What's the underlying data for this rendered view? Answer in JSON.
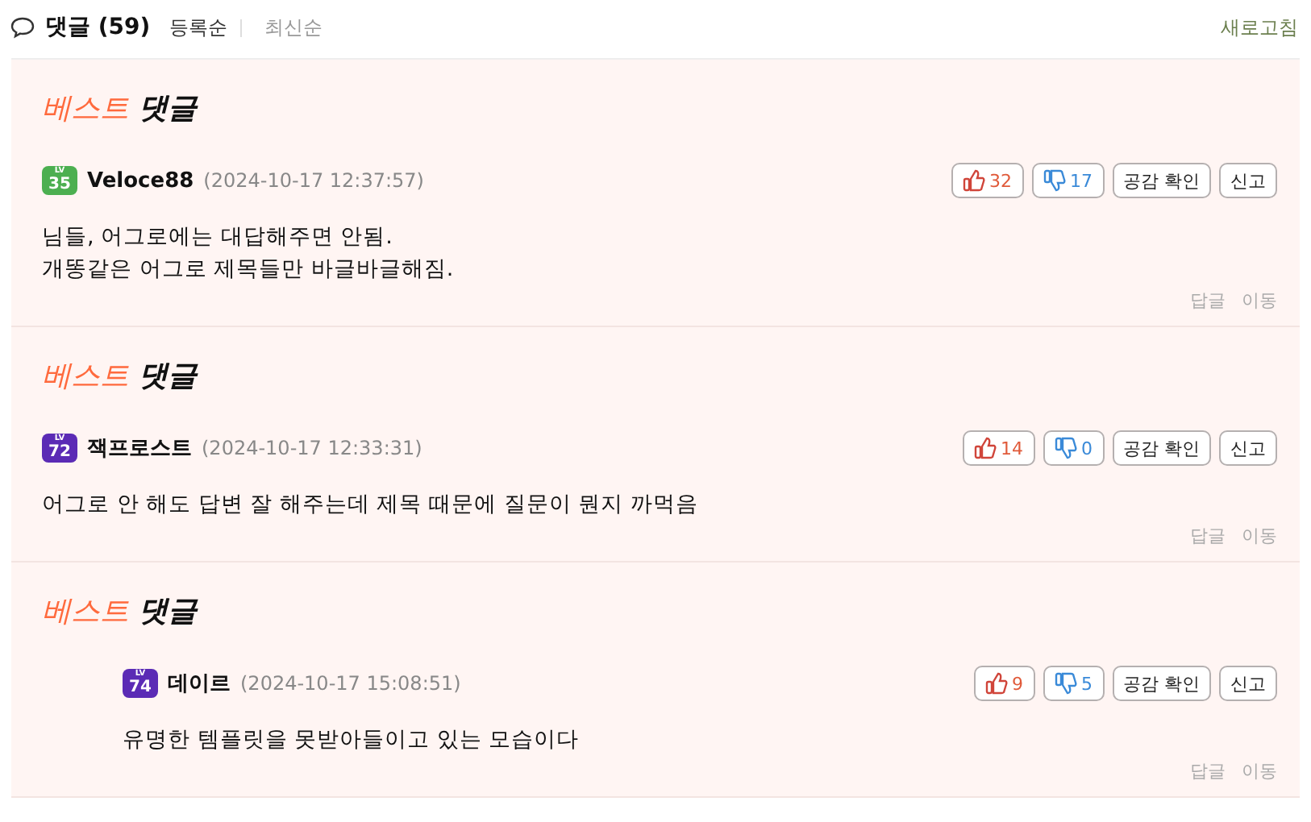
{
  "header": {
    "title": "댓글",
    "count": "(59)",
    "sort_options": [
      {
        "label": "등록순",
        "selected": true
      },
      {
        "label": "최신순",
        "selected": false
      }
    ],
    "refresh": "새로고침"
  },
  "sections": [
    {
      "title_accent": "베스트",
      "title": "댓글",
      "comment": {
        "kind": "comment",
        "badge": {
          "label": "LV",
          "level": "35",
          "color": "#4caf50"
        },
        "author": "Veloce88",
        "time": "(2024-10-17 12:37:57)",
        "likes": "32",
        "dislikes": "17",
        "actions": [
          "공감 확인",
          "신고"
        ],
        "lines": [
          "님들, 어그로에는 대답해주면 안됨.",
          "개똥같은 어그로 제목들만 바글바글해짐."
        ],
        "footer": [
          "답글",
          "이동"
        ]
      }
    },
    {
      "title_accent": "베스트",
      "title": "댓글",
      "comment": {
        "kind": "comment",
        "badge": {
          "label": "LV",
          "level": "72",
          "color": "#5b2bb5"
        },
        "author": "잭프로스트",
        "time": "(2024-10-17 12:33:31)",
        "likes": "14",
        "dislikes": "0",
        "actions": [
          "공감 확인",
          "신고"
        ],
        "lines": [
          "어그로 안 해도 답변 잘 해주는데 제목 때문에 질문이 뭔지 까먹음"
        ],
        "footer": [
          "답글",
          "이동"
        ]
      }
    },
    {
      "title_accent": "베스트",
      "title": "댓글",
      "comment": {
        "kind": "reply",
        "badge": {
          "label": "LV",
          "level": "74",
          "color": "#5b2bb5"
        },
        "author": "데이르",
        "time": "(2024-10-17 15:08:51)",
        "likes": "9",
        "dislikes": "5",
        "actions": [
          "공감 확인",
          "신고"
        ],
        "lines": [
          "유명한 템플릿을 못받아들이고 있는 모습이다"
        ],
        "footer": [
          "답글",
          "이동"
        ]
      }
    }
  ]
}
